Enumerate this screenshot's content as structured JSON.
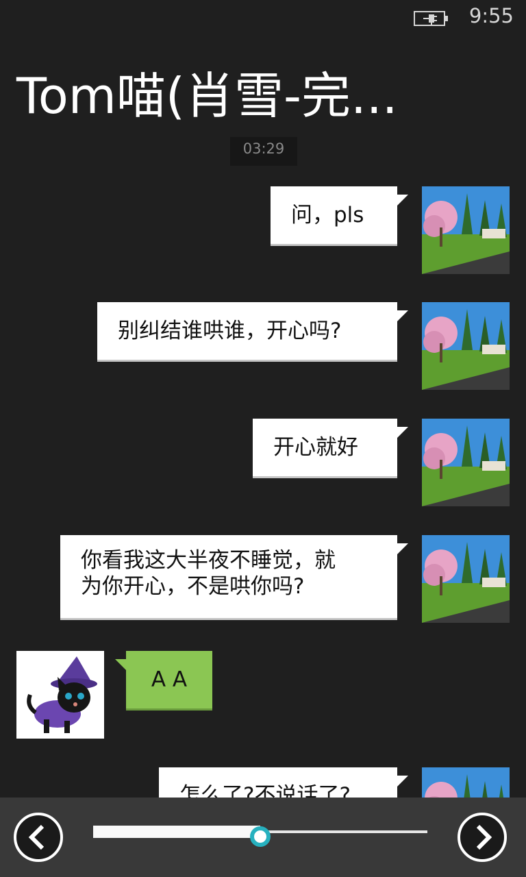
{
  "status_bar": {
    "time": "9:55",
    "battery_icon": "battery-charging-icon"
  },
  "conversation": {
    "title": "Tom喵(肖雪-完...",
    "timestamp": "03:29"
  },
  "messages": [
    {
      "direction": "outgoing",
      "text": "问，pls",
      "avatar_icon": "landscape-avatar"
    },
    {
      "direction": "outgoing",
      "text": "别纠结谁哄谁，开心吗?",
      "avatar_icon": "landscape-avatar"
    },
    {
      "direction": "outgoing",
      "text": "开心就好",
      "avatar_icon": "landscape-avatar"
    },
    {
      "direction": "outgoing",
      "lines": [
        "你看我这大半夜不睡觉，就",
        "为你开心，不是哄你吗?"
      ],
      "avatar_icon": "landscape-avatar"
    },
    {
      "direction": "incoming",
      "text": "A A",
      "avatar_icon": "black-cat-avatar"
    },
    {
      "direction": "outgoing",
      "text": "怎么了?不说话了?",
      "avatar_icon": "landscape-avatar"
    }
  ],
  "playback": {
    "prev_icon": "chevron-left-icon",
    "next_icon": "chevron-right-icon",
    "position_fraction": 0.5
  },
  "colors": {
    "background": "#1f1f1f",
    "incoming_bubble": "#8bc653",
    "outgoing_bubble": "#ffffff",
    "slider_accent": "#27b1bf"
  }
}
